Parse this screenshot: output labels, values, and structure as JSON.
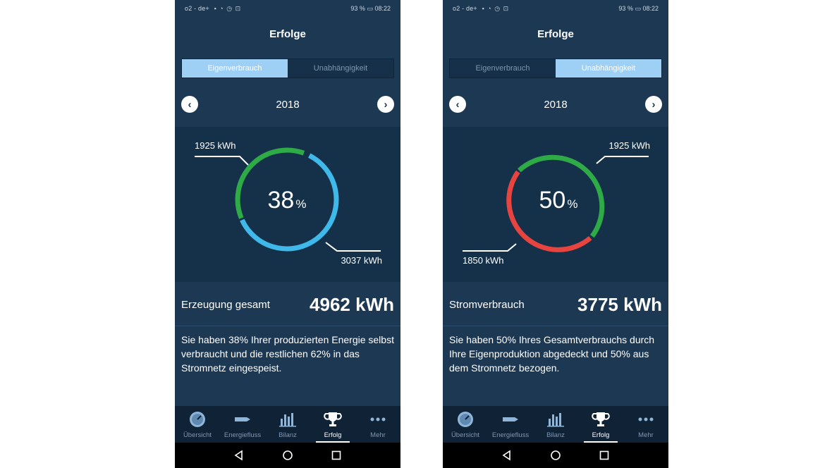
{
  "screens": [
    {
      "status": {
        "carrier": "o2 - de+",
        "battery": "93 %",
        "time": "08:22"
      },
      "title": "Erfolge",
      "tabs": [
        {
          "label": "Eigenverbrauch",
          "active": true
        },
        {
          "label": "Unabhängigkeit",
          "active": false
        }
      ],
      "year": "2018",
      "chart": {
        "percent": "38",
        "unit": "%",
        "label_top": "1925 kWh",
        "label_bottom": "3037 kWh",
        "colors": {
          "primary": "#2eaa46",
          "secondary": "#3fb8ea"
        }
      },
      "total": {
        "label": "Erzeugung gesamt",
        "value": "4962 kWh"
      },
      "description": "Sie haben 38% Ihrer produzierten Energie selbst verbraucht und die restlichen 62% in das Stromnetz eingespeist."
    },
    {
      "status": {
        "carrier": "o2 - de+",
        "battery": "93 %",
        "time": "08:22"
      },
      "title": "Erfolge",
      "tabs": [
        {
          "label": "Eigenverbrauch",
          "active": false
        },
        {
          "label": "Unabhängigkeit",
          "active": true
        }
      ],
      "year": "2018",
      "chart": {
        "percent": "50",
        "unit": "%",
        "label_top": "1925 kWh",
        "label_bottom": "1850 kWh",
        "colors": {
          "primary": "#2eaa46",
          "secondary": "#e8443f"
        }
      },
      "total": {
        "label": "Stromverbrauch",
        "value": "3775 kWh"
      },
      "description": "Sie haben 50% Ihres Gesamtverbrauchs durch Ihre Eigenproduktion abgedeckt und 50% aus dem Stromnetz bezogen."
    }
  ],
  "bottom_nav": [
    {
      "label": "Übersicht",
      "icon": "gauge-icon"
    },
    {
      "label": "Energiefluss",
      "icon": "flow-arrow-icon"
    },
    {
      "label": "Bilanz",
      "icon": "bar-chart-icon"
    },
    {
      "label": "Erfolg",
      "icon": "trophy-icon"
    },
    {
      "label": "Mehr",
      "icon": "more-dots-icon"
    }
  ],
  "bottom_nav_active": "Erfolg",
  "colors": {
    "background": "#1c3853",
    "panel": "#15314a",
    "tab_active": "#9ecff4",
    "tabbar": "#0f2236"
  }
}
